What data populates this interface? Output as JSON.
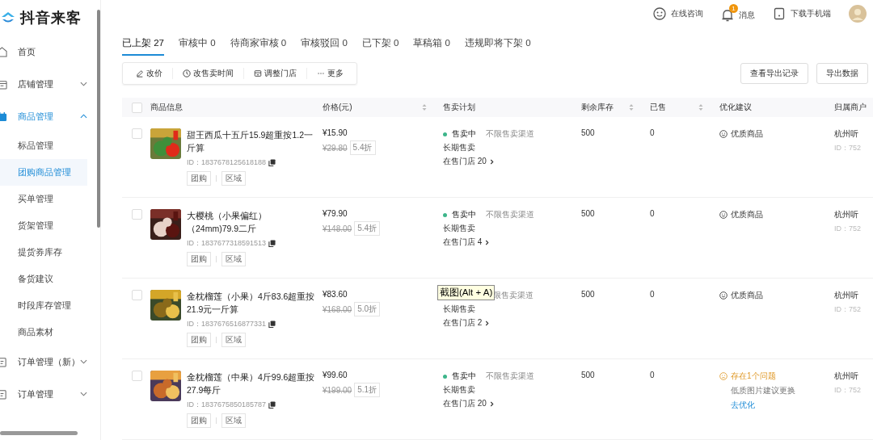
{
  "app": {
    "name": "抖音来客"
  },
  "sidebar": {
    "items": [
      {
        "label": "首页"
      },
      {
        "label": "店铺管理",
        "expanded": false
      },
      {
        "label": "商品管理",
        "expanded": true,
        "children": [
          {
            "label": "标品管理",
            "selected": false
          },
          {
            "label": "团购商品管理",
            "selected": true
          },
          {
            "label": "买单管理",
            "selected": false
          },
          {
            "label": "货架管理",
            "selected": false
          },
          {
            "label": "提货券库存",
            "selected": false
          },
          {
            "label": "备货建议",
            "selected": false
          },
          {
            "label": "时段库存管理",
            "selected": false
          },
          {
            "label": "商品素材",
            "selected": false
          }
        ]
      },
      {
        "label": "订单管理（新）",
        "expanded": false
      },
      {
        "label": "订单管理",
        "expanded": false
      }
    ]
  },
  "header": {
    "consult": "在线咨询",
    "messages": "消息",
    "message_badge": "1",
    "download": "下载手机端"
  },
  "tabs": [
    {
      "label": "已上架",
      "count": "27",
      "selected": true
    },
    {
      "label": "审核中",
      "count": "0",
      "selected": false
    },
    {
      "label": "待商家审核",
      "count": "0",
      "selected": false
    },
    {
      "label": "审核驳回",
      "count": "0",
      "selected": false
    },
    {
      "label": "已下架",
      "count": "0",
      "selected": false
    },
    {
      "label": "草稿箱",
      "count": "0",
      "selected": false
    },
    {
      "label": "违规即将下架",
      "count": "0",
      "selected": false
    }
  ],
  "toolbar": {
    "actions": [
      "改价",
      "改售卖时间",
      "调整门店",
      "更多"
    ],
    "export_records": "查看导出记录",
    "export_data": "导出数据"
  },
  "table": {
    "select_all_checked": false,
    "columns": [
      {
        "label": "商品信息",
        "sortable": false
      },
      {
        "label": "价格(元)",
        "sortable": true
      },
      {
        "label": "售卖计划",
        "sortable": false
      },
      {
        "label": "剩余库存",
        "sortable": true
      },
      {
        "label": "已售",
        "sortable": true
      },
      {
        "label": "优化建议",
        "sortable": false
      },
      {
        "label": "归属商户"
      }
    ],
    "rows": [
      {
        "checked": false,
        "title": "甜王西瓜十五斤15.9超重按1.2一斤算",
        "id": "ID：1837678125618188",
        "tags": [
          "团购",
          "区域"
        ],
        "price": "¥15.90",
        "original_price": "¥29.80",
        "discount": "5.4折",
        "status": "售卖中",
        "channel": "不限售卖渠道",
        "period": "长期售卖",
        "stores": "在售门店 20",
        "stock": "500",
        "sold": "0",
        "suggestion": {
          "kind": "good",
          "text": "优质商品"
        },
        "merchant": "杭州听",
        "merchant_id": "ID：752"
      },
      {
        "checked": false,
        "title": "大樱桃（小果偏红）（24mm)79.9二斤",
        "id": "ID：1837677318591513",
        "tags": [
          "团购",
          "区域"
        ],
        "price": "¥79.90",
        "original_price": "¥148.00",
        "discount": "5.4折",
        "status": "售卖中",
        "channel": "不限售卖渠道",
        "period": "长期售卖",
        "stores": "在售门店 4",
        "stock": "500",
        "sold": "0",
        "suggestion": {
          "kind": "good",
          "text": "优质商品"
        },
        "merchant": "杭州听",
        "merchant_id": "ID：752"
      },
      {
        "checked": false,
        "title": "金枕榴莲（小果）4斤83.6超重按21.9元一斤算",
        "id": "ID：1837676516877331",
        "tags": [
          "团购",
          "区域"
        ],
        "price": "¥83.60",
        "original_price": "¥168.00",
        "discount": "5.0折",
        "channel": "限售卖渠道",
        "period": "长期售卖",
        "stores": "在售门店 2",
        "stock": "500",
        "sold": "0",
        "suggestion": {
          "kind": "good",
          "text": "优质商品"
        },
        "merchant": "杭州听",
        "merchant_id": "ID：752"
      },
      {
        "checked": false,
        "title": "金枕榴莲（中果）4斤99.6超重按27.9每斤",
        "id": "ID：1837675850185787",
        "tags": [
          "团购",
          "区域"
        ],
        "price": "¥99.60",
        "original_price": "¥199.00",
        "discount": "5.1折",
        "status": "售卖中",
        "channel": "不限售卖渠道",
        "period": "长期售卖",
        "stores": "在售门店 20",
        "stock": "500",
        "sold": "0",
        "suggestion": {
          "kind": "issue",
          "text": "存在1个问题",
          "detail": "低质图片建议更换",
          "action": "去优化"
        },
        "merchant": "杭州听",
        "merchant_id": "ID：752"
      }
    ]
  },
  "tooltip": "截图(Alt + A)"
}
